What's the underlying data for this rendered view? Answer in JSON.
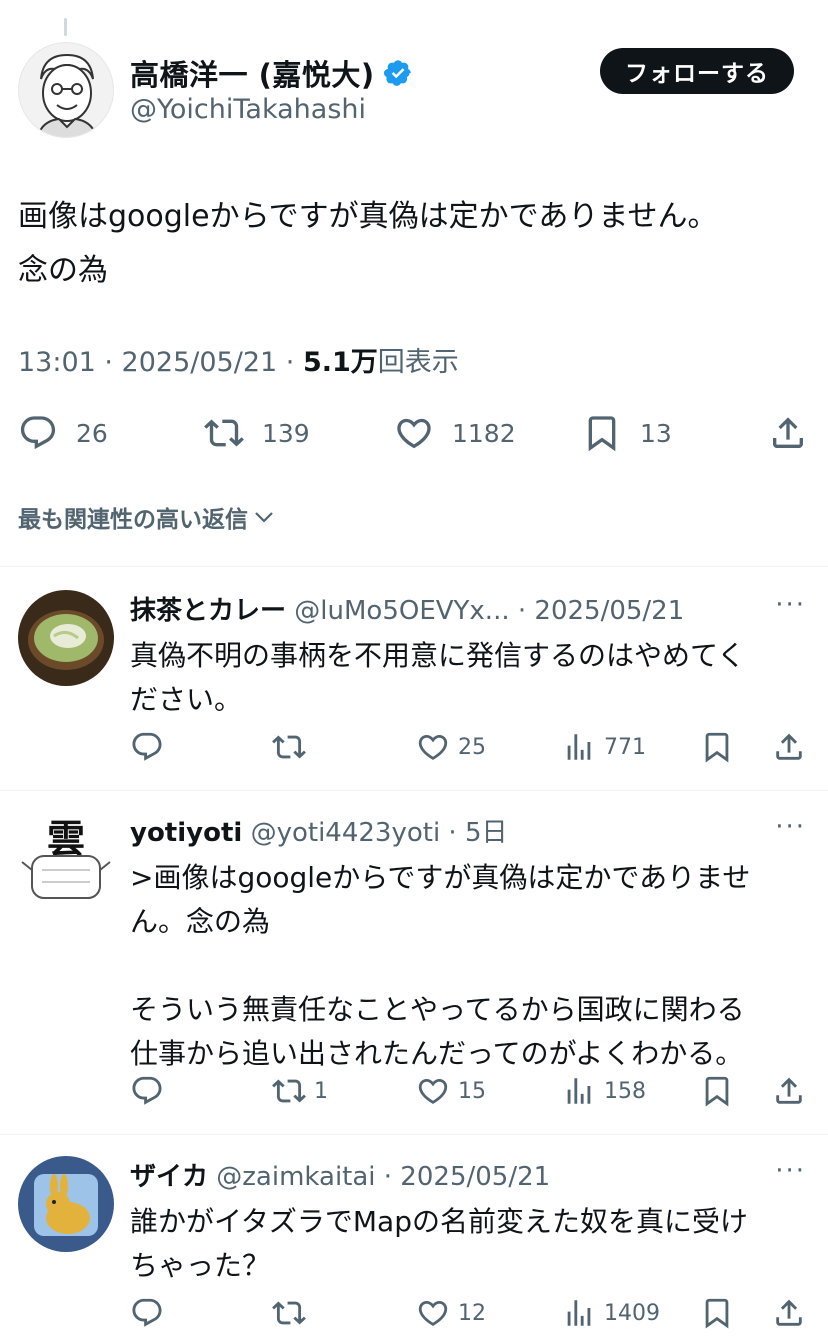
{
  "main_tweet": {
    "author_name": "高橋洋一 (嘉悦大)",
    "author_handle": "@YoichiTakahashi",
    "follow_label": "フォローする",
    "text": "画像はgoogleからですが真偽は定かでありません。\n念の為",
    "time": "13:01 · 2025/05/21 · ",
    "views_count": "5.1万",
    "views_suffix": "回表示",
    "replies": "26",
    "retweets": "139",
    "likes": "1182",
    "bookmarks": "13"
  },
  "sort_label": "最も関連性の高い返信",
  "replies": [
    {
      "name": "抹茶とカレー",
      "handle_date": " @luMo5OEVYx... · 2025/05/21",
      "more": "···",
      "text": "真偽不明の事柄を不用意に発信するのはやめてください。",
      "text_display": "真偽不明の事柄を不用意に発信するのはやめてく\nださい。",
      "retweets": "",
      "likes": "25",
      "views": "771"
    },
    {
      "name": "yotiyoti",
      "handle_date": " @yoti4423yoti · 5日",
      "more": "···",
      "text_display": ">画像はgoogleからですが真偽は定かでありませ\nん。念の為\n\nそういう無責任なことやってるから国政に関わる\n仕事から追い出されたんだってのがよくわかる。",
      "retweets": "1",
      "likes": "15",
      "views": "158"
    },
    {
      "name": "ザイカ",
      "handle_date": " @zaimkaitai · 2025/05/21",
      "more": "···",
      "text_display": "誰かがイタズラでMapの名前変えた奴を真に受け\nちゃった？",
      "retweets": "",
      "likes": "12",
      "views": "1409"
    }
  ],
  "colors": {
    "text": "#0f1419",
    "muted": "#536471",
    "verified": "#1d9bf0",
    "divider": "#eff3f4"
  }
}
